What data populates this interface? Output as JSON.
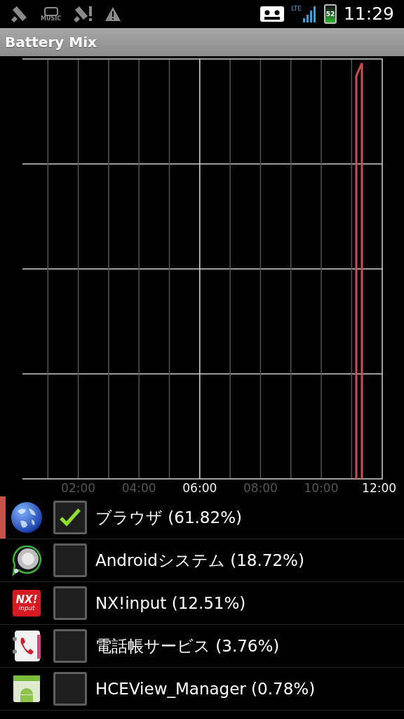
{
  "status_bar": {
    "music_label": "MUSIC",
    "network": "LTE",
    "battery": "52",
    "time": "11:29"
  },
  "title_bar": {
    "title": "Battery Mix"
  },
  "chart": {
    "x_labels": [
      {
        "label": "02:00",
        "major": false
      },
      {
        "label": "04:00",
        "major": false
      },
      {
        "label": "06:00",
        "major": true
      },
      {
        "label": "08:00",
        "major": false
      },
      {
        "label": "10:00",
        "major": false
      },
      {
        "label": "12:00",
        "major": true
      }
    ]
  },
  "apps": [
    {
      "kind": "globe",
      "name": "ブラウザ (61.82%)",
      "checked": true
    },
    {
      "kind": "disc",
      "name": "Androidシステム (18.72%)",
      "checked": false
    },
    {
      "kind": "nx",
      "name": "NX!input (12.51%)",
      "checked": false,
      "icon_text": "NX!",
      "icon_subtext": "input"
    },
    {
      "kind": "phonebook",
      "name": "電話帳サービス (3.76%)",
      "checked": false
    },
    {
      "kind": "android",
      "name": "HCEView_Manager (0.78%)",
      "checked": false
    }
  ]
}
